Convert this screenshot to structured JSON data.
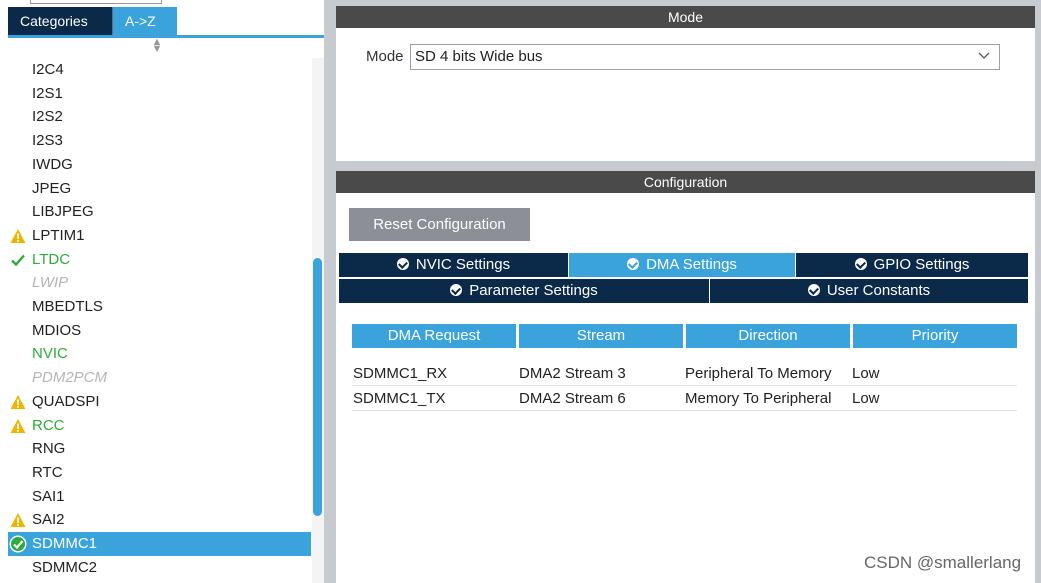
{
  "left_panel": {
    "tabs": [
      {
        "label": "Categories",
        "active": false
      },
      {
        "label": "A->Z",
        "active": true
      }
    ],
    "items": [
      {
        "label": "I2C4",
        "state": "normal",
        "icon": ""
      },
      {
        "label": "I2S1",
        "state": "normal",
        "icon": ""
      },
      {
        "label": "I2S2",
        "state": "normal",
        "icon": ""
      },
      {
        "label": "I2S3",
        "state": "normal",
        "icon": ""
      },
      {
        "label": "IWDG",
        "state": "normal",
        "icon": ""
      },
      {
        "label": "JPEG",
        "state": "normal",
        "icon": ""
      },
      {
        "label": "LIBJPEG",
        "state": "normal",
        "icon": ""
      },
      {
        "label": "LPTIM1",
        "state": "normal",
        "icon": "warning-icon"
      },
      {
        "label": "LTDC",
        "state": "green",
        "icon": "check-icon"
      },
      {
        "label": "LWIP",
        "state": "disabled",
        "icon": ""
      },
      {
        "label": "MBEDTLS",
        "state": "normal",
        "icon": ""
      },
      {
        "label": "MDIOS",
        "state": "normal",
        "icon": ""
      },
      {
        "label": "NVIC",
        "state": "green",
        "icon": ""
      },
      {
        "label": "PDM2PCM",
        "state": "disabled",
        "icon": ""
      },
      {
        "label": "QUADSPI",
        "state": "normal",
        "icon": "warning-icon"
      },
      {
        "label": "RCC",
        "state": "green",
        "icon": "warning-icon"
      },
      {
        "label": "RNG",
        "state": "normal",
        "icon": ""
      },
      {
        "label": "RTC",
        "state": "normal",
        "icon": ""
      },
      {
        "label": "SAI1",
        "state": "normal",
        "icon": ""
      },
      {
        "label": "SAI2",
        "state": "normal",
        "icon": "warning-icon"
      },
      {
        "label": "SDMMC1",
        "state": "selected",
        "icon": "check-circle-icon"
      },
      {
        "label": "SDMMC2",
        "state": "normal",
        "icon": ""
      }
    ]
  },
  "mode": {
    "header": "Mode",
    "label": "Mode",
    "selected": "SD 4 bits Wide bus"
  },
  "config": {
    "header": "Configuration",
    "reset_label": "Reset Configuration",
    "tabs_row1": [
      {
        "label": "NVIC Settings",
        "active": false
      },
      {
        "label": "DMA Settings",
        "active": true
      },
      {
        "label": "GPIO Settings",
        "active": false
      }
    ],
    "tabs_row2": [
      {
        "label": "Parameter Settings",
        "active": false
      },
      {
        "label": "User Constants",
        "active": false
      }
    ],
    "table": {
      "headers": [
        "DMA Request",
        "Stream",
        "Direction",
        "Priority"
      ],
      "rows": [
        [
          "SDMMC1_RX",
          "DMA2 Stream 3",
          "Peripheral To Memory",
          "Low"
        ],
        [
          "SDMMC1_TX",
          "DMA2 Stream 6",
          "Memory To Peripheral",
          "Low"
        ]
      ]
    }
  },
  "watermark": "CSDN @smallerlang",
  "colors": {
    "accent": "#3aa3dc",
    "navy": "#0b2a4a",
    "header_gray": "#4a4a4a",
    "ok_green": "#2bab3a",
    "warning_yellow": "#f0b400"
  }
}
